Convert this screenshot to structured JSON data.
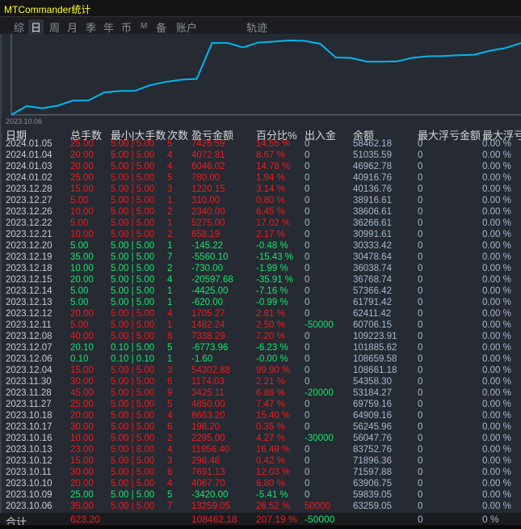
{
  "title": "MTCommander统计",
  "tabs": [
    "综",
    "日",
    "周",
    "月",
    "季",
    "年",
    "币",
    "M",
    "备",
    "账户",
    "轨迹"
  ],
  "active_tab": "日",
  "chart": {
    "start_label": "2023.10.06",
    "line_color": "#00b8f0"
  },
  "headers": [
    "日期",
    "总手数",
    "最小|大手数",
    "次数",
    "盈亏金额",
    "百分比%",
    "出入金",
    "余额",
    "最大浮亏金额",
    "最大浮亏"
  ],
  "rows": [
    [
      "2024.01.05",
      "25.00",
      "5.00 | 5.00",
      "5",
      "7426.59",
      "14.55 %",
      "0",
      "58462.18",
      "0",
      "0.00 %"
    ],
    [
      "2024.01.04",
      "20.00",
      "5.00 | 5.00",
      "4",
      "4072.81",
      "8.67 %",
      "0",
      "51035.59",
      "0",
      "0.00 %"
    ],
    [
      "2024.01.03",
      "20.00",
      "5.00 | 5.00",
      "4",
      "6046.02",
      "14.78 %",
      "0",
      "46962.78",
      "0",
      "0.00 %"
    ],
    [
      "2024.01.02",
      "25.00",
      "5.00 | 5.00",
      "5",
      "780.00",
      "1.94 %",
      "0",
      "40916.76",
      "0",
      "0.00 %"
    ],
    [
      "2023.12.28",
      "15.00",
      "5.00 | 5.00",
      "3",
      "1220.15",
      "3.14 %",
      "0",
      "40136.76",
      "0",
      "0.00 %"
    ],
    [
      "2023.12.27",
      "5.00",
      "5.00 | 5.00",
      "1",
      "310.00",
      "0.80 %",
      "0",
      "38916.61",
      "0",
      "0.00 %"
    ],
    [
      "2023.12.26",
      "10.00",
      "5.00 | 5.00",
      "2",
      "2340.00",
      "6.45 %",
      "0",
      "38606.61",
      "0",
      "0.00 %"
    ],
    [
      "2023.12.22",
      "5.00",
      "5.00 | 5.00",
      "1",
      "5275.00",
      "17.02 %",
      "0",
      "36266.61",
      "0",
      "0.00 %"
    ],
    [
      "2023.12.21",
      "10.00",
      "5.00 | 5.00",
      "2",
      "658.19",
      "2.17 %",
      "0",
      "30991.61",
      "0",
      "0.00 %"
    ],
    [
      "2023.12.20",
      "5.00",
      "5.00 | 5.00",
      "1",
      "-145.22",
      "-0.48 %",
      "0",
      "30333.42",
      "0",
      "0.00 %"
    ],
    [
      "2023.12.19",
      "35.00",
      "5.00 | 5.00",
      "7",
      "-5560.10",
      "-15.43 %",
      "0",
      "30478.64",
      "0",
      "0.00 %"
    ],
    [
      "2023.12.18",
      "10.00",
      "5.00 | 5.00",
      "2",
      "-730.00",
      "-1.99 %",
      "0",
      "36038.74",
      "0",
      "0.00 %"
    ],
    [
      "2023.12.15",
      "20.00",
      "5.00 | 5.00",
      "4",
      "-20597.68",
      "-35.91 %",
      "0",
      "36768.74",
      "0",
      "0.00 %"
    ],
    [
      "2023.12.14",
      "5.00",
      "5.00 | 5.00",
      "1",
      "-4425.00",
      "-7.16 %",
      "0",
      "57366.42",
      "0",
      "0.00 %"
    ],
    [
      "2023.12.13",
      "5.00",
      "5.00 | 5.00",
      "1",
      "-620.00",
      "-0.99 %",
      "0",
      "61791.42",
      "0",
      "0.00 %"
    ],
    [
      "2023.12.12",
      "20.00",
      "5.00 | 5.00",
      "4",
      "1705.27",
      "2.81 %",
      "0",
      "62411.42",
      "0",
      "0.00 %"
    ],
    [
      "2023.12.11",
      "5.00",
      "5.00 | 5.00",
      "1",
      "1482.24",
      "2.50 %",
      "-50000",
      "60706.15",
      "0",
      "0.00 %"
    ],
    [
      "2023.12.08",
      "40.00",
      "5.00 | 5.00",
      "8",
      "7338.29",
      "7.20 %",
      "0",
      "109223.91",
      "0",
      "0.00 %"
    ],
    [
      "2023.12.07",
      "20.10",
      "0.10 | 5.00",
      "5",
      "-6773.96",
      "-6.23 %",
      "0",
      "101885.62",
      "0",
      "0.00 %"
    ],
    [
      "2023.12.06",
      "0.10",
      "0.10 | 0.10",
      "1",
      "-1.60",
      "-0.00 %",
      "0",
      "108659.58",
      "0",
      "0.00 %"
    ],
    [
      "2023.12.04",
      "15.00",
      "5.00 | 5.00",
      "3",
      "54302.88",
      "99.90 %",
      "0",
      "108661.18",
      "0",
      "0.00 %"
    ],
    [
      "2023.11.30",
      "30.00",
      "5.00 | 5.00",
      "6",
      "1174.03",
      "2.21 %",
      "0",
      "54358.30",
      "0",
      "0.00 %"
    ],
    [
      "2023.11.28",
      "45.00",
      "5.00 | 5.00",
      "9",
      "3425.11",
      "6.88 %",
      "-20000",
      "53184.27",
      "0",
      "0.00 %"
    ],
    [
      "2023.11.27",
      "25.00",
      "5.00 | 5.00",
      "5",
      "4850.00",
      "7.47 %",
      "0",
      "69759.16",
      "0",
      "0.00 %"
    ],
    [
      "2023.10.18",
      "20.00",
      "5.00 | 5.00",
      "4",
      "8663.20",
      "15.40 %",
      "0",
      "64909.16",
      "0",
      "0.00 %"
    ],
    [
      "2023.10.17",
      "30.00",
      "5.00 | 5.00",
      "6",
      "198.20",
      "0.35 %",
      "0",
      "56245.96",
      "0",
      "0.00 %"
    ],
    [
      "2023.10.16",
      "10.00",
      "5.00 | 5.00",
      "2",
      "2295.00",
      "4.27 %",
      "-30000",
      "56047.76",
      "0",
      "0.00 %"
    ],
    [
      "2023.10.13",
      "23.00",
      "5.00 | 8.00",
      "4",
      "11856.40",
      "16.49 %",
      "0",
      "83752.76",
      "0",
      "0.00 %"
    ],
    [
      "2023.10.12",
      "15.00",
      "5.00 | 5.00",
      "3",
      "298.48",
      "0.42 %",
      "0",
      "71896.36",
      "0",
      "0.00 %"
    ],
    [
      "2023.10.11",
      "30.00",
      "5.00 | 5.00",
      "6",
      "7691.13",
      "12.03 %",
      "0",
      "71597.88",
      "0",
      "0.00 %"
    ],
    [
      "2023.10.10",
      "20.00",
      "5.00 | 5.00",
      "4",
      "4067.70",
      "6.80 %",
      "0",
      "63906.75",
      "0",
      "0.00 %"
    ],
    [
      "2023.10.09",
      "25.00",
      "5.00 | 5.00",
      "5",
      "-3420.00",
      "-5.41 %",
      "0",
      "59839.05",
      "0",
      "0.00 %"
    ],
    [
      "2023.10.06",
      "35.00",
      "5.00 | 5.00",
      "7",
      "13259.05",
      "26.52 %",
      "50000",
      "63259.05",
      "0",
      "0.00 %"
    ]
  ],
  "total": {
    "label": "合计",
    "lots": "623.20",
    "pnl": "108462.18",
    "pct": "207.19 %",
    "inout": "-50000",
    "maxfloat": "0",
    "maxfloatpct": "0 %"
  },
  "colors": {
    "profit": "#ee1c1c",
    "loss": "#14e86a",
    "title": "#ffff30"
  }
}
